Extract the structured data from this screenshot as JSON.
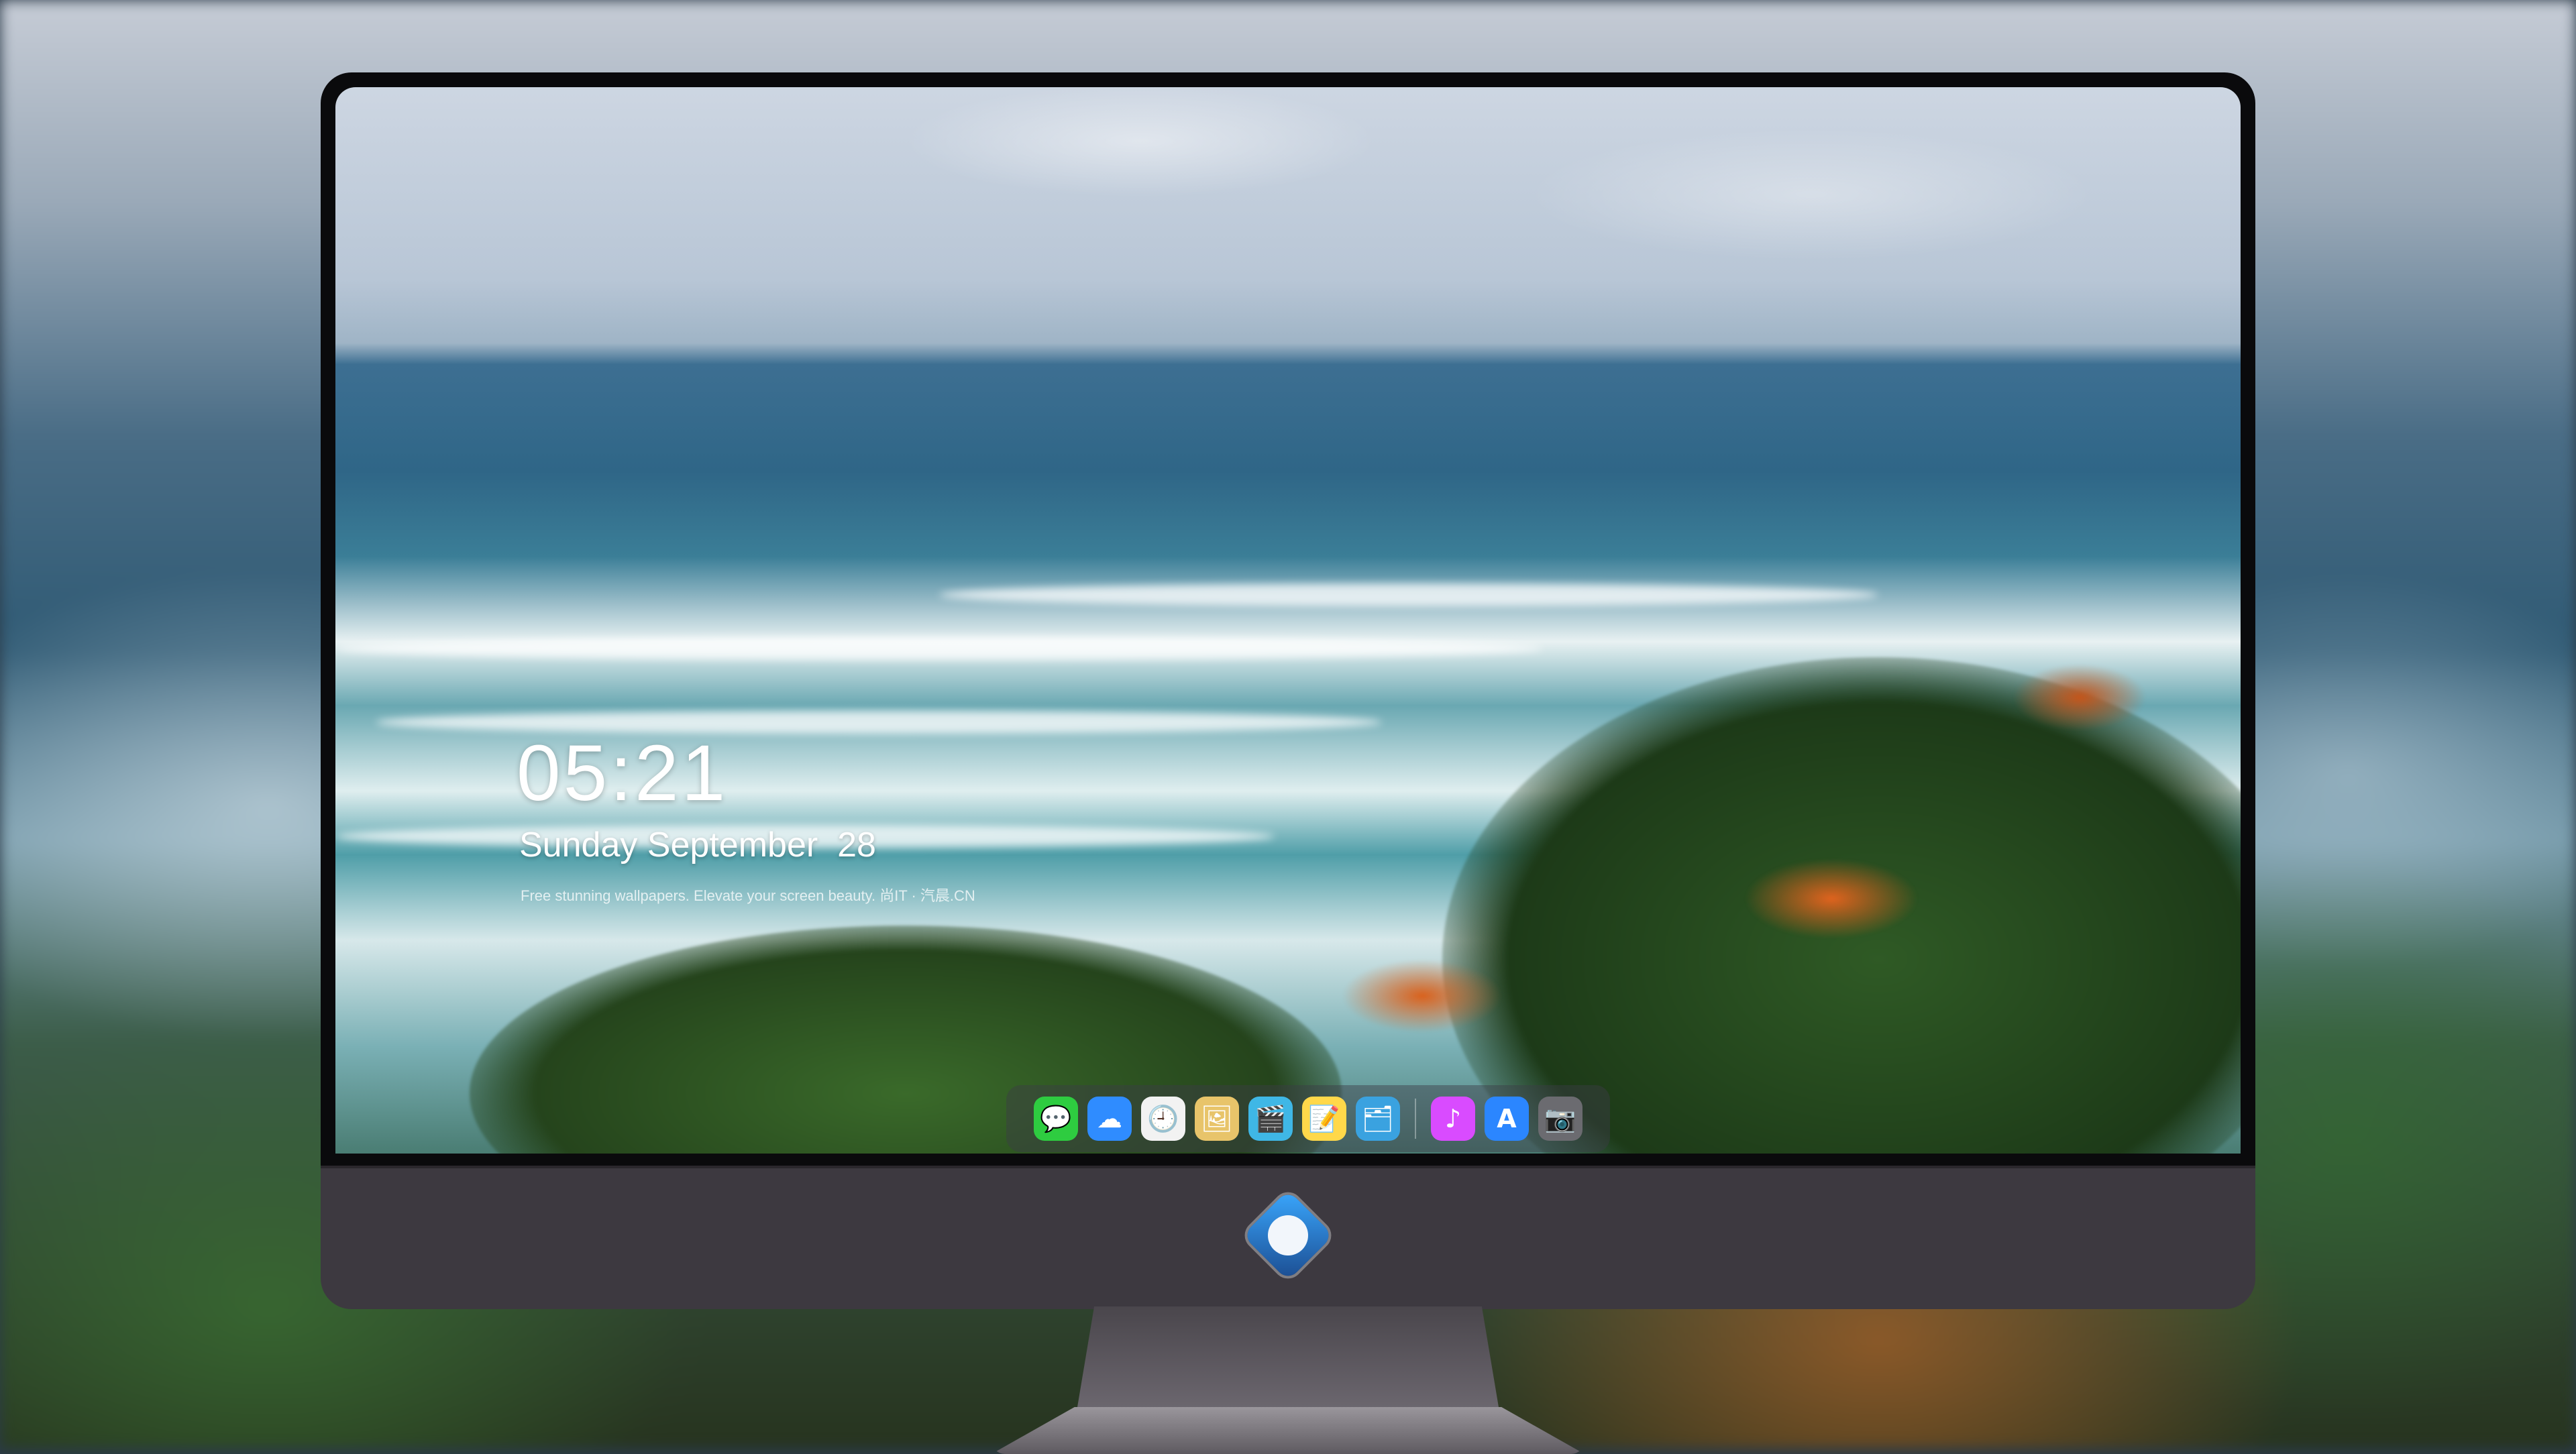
{
  "lock_screen": {
    "time": "05:21",
    "date": "Sunday September  28",
    "tagline": "Free stunning wallpapers. Elevate your screen beauty. 尚IT · 汽晨.CN"
  },
  "dock": {
    "items": [
      {
        "name": "messages-icon",
        "glyph": "💬",
        "color": "#2ecc40"
      },
      {
        "name": "weather-icon",
        "glyph": "☁",
        "color": "#2f8cff"
      },
      {
        "name": "clock-icon",
        "glyph": "🕘",
        "color": "#f2f2f2"
      },
      {
        "name": "preview-icon",
        "glyph": "🖼",
        "color": "#e8c46a"
      },
      {
        "name": "clips-icon",
        "glyph": "🎬",
        "color": "#3fb7e6"
      },
      {
        "name": "notes-icon",
        "glyph": "📝",
        "color": "#ffd84a"
      },
      {
        "name": "photo-booth-icon",
        "glyph": "🗂",
        "color": "#3aa2e0"
      },
      {
        "name": "music-icon",
        "glyph": "♪",
        "color": "#d94bff"
      },
      {
        "name": "app-store-icon",
        "glyph": "A",
        "color": "#2b86ff"
      },
      {
        "name": "camera-icon",
        "glyph": "📷",
        "color": "#6b6b70"
      }
    ]
  },
  "colors": {
    "bezel": "#0a0a0c",
    "chin": "#3d3940",
    "clock_text": "#ffffff"
  }
}
